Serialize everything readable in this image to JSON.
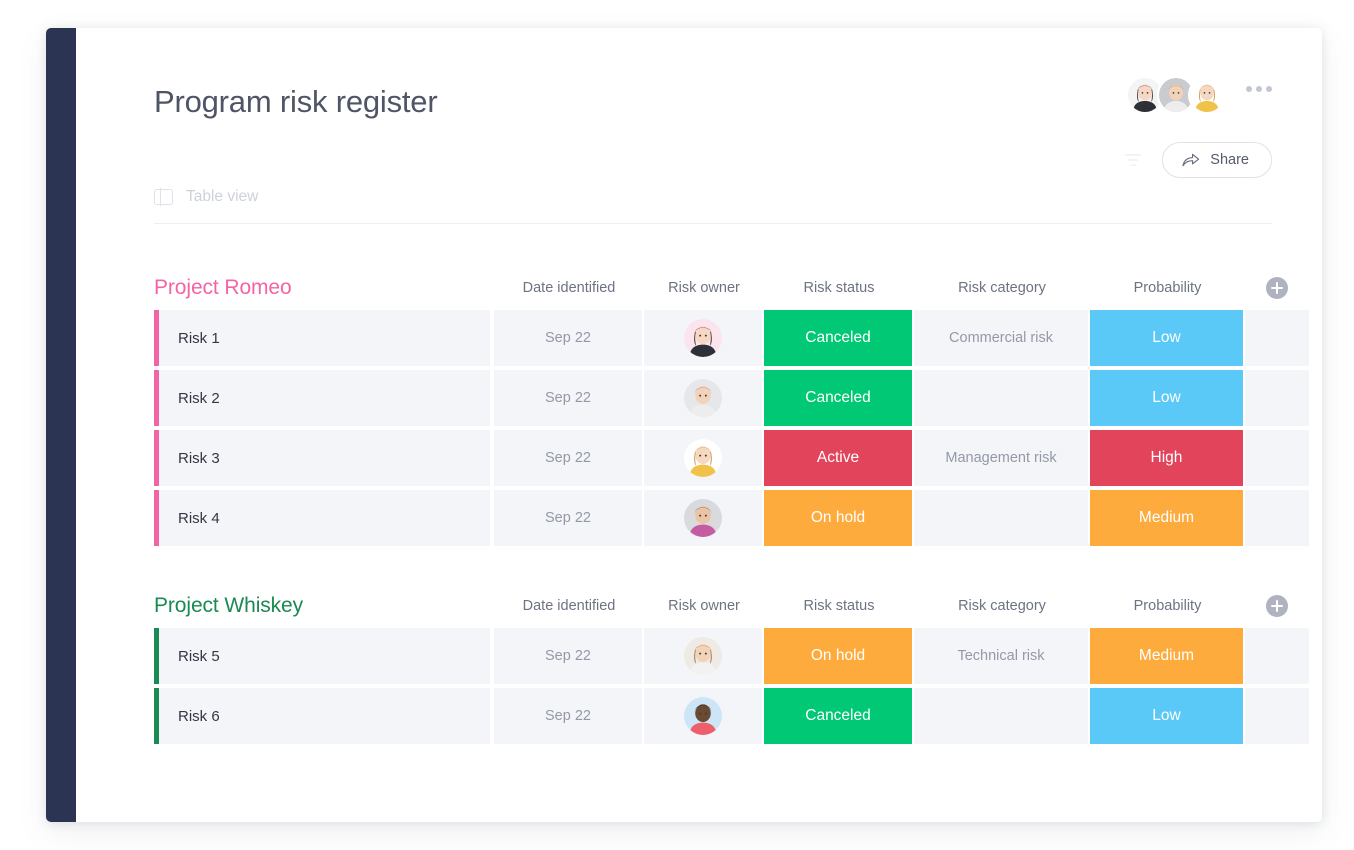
{
  "header": {
    "title": "Program risk register",
    "share_label": "Share",
    "share_icon": "share-arrow-icon",
    "filter_icon": "filter-icon",
    "more_icon": "more-options-icon",
    "avatars": [
      "avatar-user-1",
      "avatar-user-2",
      "avatar-user-3"
    ]
  },
  "view": {
    "icon": "table-view-icon",
    "label": "Table view"
  },
  "columns": {
    "item": "",
    "date": "Date identified",
    "owner": "Risk owner",
    "status": "Risk status",
    "category": "Risk category",
    "probability": "Probability",
    "add": "add-column-icon"
  },
  "colors": {
    "rail": "#2B3553",
    "green": "#00C875",
    "red": "#E2445C",
    "orange": "#FDAB3D",
    "blue": "#5AC9F8",
    "cell_bg": "#F4F5F8",
    "group_romeo": "#F364A7",
    "group_whiskey": "#1A8A52"
  },
  "groups": [
    {
      "title": "Project Romeo",
      "color": "#F364A7",
      "accent": "#F364A7",
      "rows": [
        {
          "name": "Risk 1",
          "date": "Sep 22",
          "owner": "avatar-risk-owner-1",
          "owner_bg": "#FCE4EF",
          "status": "Canceled",
          "status_color": "#00C875",
          "category": "Commercial risk",
          "probability": "Low",
          "probability_color": "#5AC9F8"
        },
        {
          "name": "Risk 2",
          "date": "Sep 22",
          "owner": "avatar-risk-owner-2",
          "owner_bg": "#E6E7EA",
          "status": "Canceled",
          "status_color": "#00C875",
          "category": "",
          "probability": "Low",
          "probability_color": "#5AC9F8"
        },
        {
          "name": "Risk 3",
          "date": "Sep 22",
          "owner": "avatar-risk-owner-3",
          "owner_bg": "#FFFFFF",
          "status": "Active",
          "status_color": "#E2445C",
          "category": "Management risk",
          "probability": "High",
          "probability_color": "#E2445C"
        },
        {
          "name": "Risk 4",
          "date": "Sep 22",
          "owner": "avatar-risk-owner-4",
          "owner_bg": "#D9DADE",
          "status": "On hold",
          "status_color": "#FDAB3D",
          "category": "",
          "probability": "Medium",
          "probability_color": "#FDAB3D"
        }
      ]
    },
    {
      "title": "Project Whiskey",
      "color": "#1A8A52",
      "accent": "#1A8A52",
      "rows": [
        {
          "name": "Risk 5",
          "date": "Sep 22",
          "owner": "avatar-risk-owner-5",
          "owner_bg": "#EFEAE4",
          "status": "On hold",
          "status_color": "#FDAB3D",
          "category": "Technical risk",
          "probability": "Medium",
          "probability_color": "#FDAB3D"
        },
        {
          "name": "Risk 6",
          "date": "Sep 22",
          "owner": "avatar-risk-owner-6",
          "owner_bg": "#CDE6F7",
          "status": "Canceled",
          "status_color": "#00C875",
          "category": "",
          "probability": "Low",
          "probability_color": "#5AC9F8"
        }
      ]
    }
  ]
}
